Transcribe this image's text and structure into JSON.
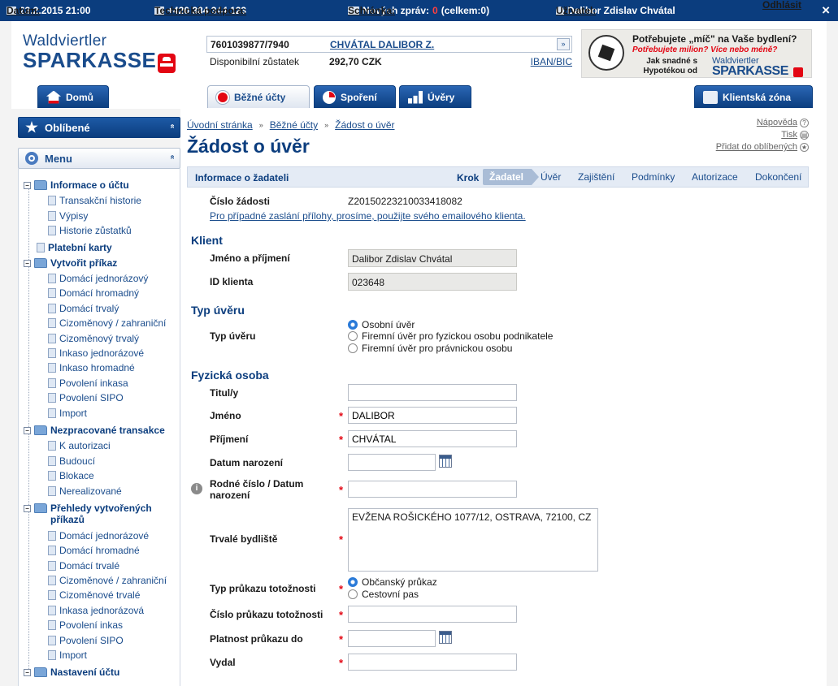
{
  "topbar": {
    "date_label": "Datum:",
    "date_value": "23.2.2015 21:00",
    "support_label": "Technická podpora:",
    "support_value": "+420 384 344 123",
    "inbox_label": "Schránka:",
    "inbox_new": "Nových zpráv:",
    "inbox_zero": "0",
    "inbox_total": "(celkem:0)",
    "user_label": "Uživatel:",
    "user_value": "Dalibor Zdislav Chvátal",
    "logout": "Odhlásit",
    "close": "×"
  },
  "logo": {
    "line1": "Waldviertler",
    "line2": "SPARKASSE"
  },
  "account": {
    "number": "7601039877/7940",
    "owner": "CHVÁTAL DALIBOR Z.",
    "dropdown": "»",
    "balance_label": "Disponibilní zůstatek",
    "balance_value": "292,70 CZK",
    "iban_link": "IBAN/BIC"
  },
  "banner": {
    "t1": "Potřebujete „míč\" na Vaše bydlení?",
    "t2": "Potřebujete milion? Více nebo méně?",
    "t3": "Jak snadné s Hypotékou od",
    "brand1": "Waldviertler",
    "brand2": "SPARKASSE"
  },
  "nav": {
    "home": "Domů",
    "current": "Běžné účty",
    "savings": "Spoření",
    "loans": "Úvěry",
    "client": "Klientská zóna"
  },
  "sidebar": {
    "favorites": "Oblíbené",
    "menu": "Menu",
    "toggle": "»",
    "items": [
      "Informace o účtu",
      "Transakční historie",
      "Výpisy",
      "Historie zůstatků",
      "Platební karty",
      "Vytvořit příkaz",
      "Domácí jednorázový",
      "Domácí hromadný",
      "Domácí trvalý",
      "Cizoměnový / zahraniční",
      "Cizoměnový trvalý",
      "Inkaso jednorázové",
      "Inkaso hromadné",
      "Povolení inkasa",
      "Povolení SIPO",
      "Import",
      "Nezpracované transakce",
      "K autorizaci",
      "Budoucí",
      "Blokace",
      "Nerealizované",
      "Přehledy vytvořených",
      "příkazů",
      "Domácí jednorázové",
      "Domácí hromadné",
      "Domácí trvalé",
      "Cizoměnové / zahraniční",
      "Cizoměnové trvalé",
      "Inkasa jednorázová",
      "Povolení inkas",
      "Povolení SIPO",
      "Import",
      "Nastavení účtu"
    ]
  },
  "breadcrumb": [
    "Úvodní stránka",
    "Běžné účty",
    "Žádost o úvěr"
  ],
  "breadcrumb_sep": "»",
  "page_title": "Žádost o úvěr",
  "utilities": {
    "help": "Nápověda",
    "print": "Tisk",
    "add_fav": "Přidat do oblíbených"
  },
  "steps": {
    "header": "Informace o žadateli",
    "krok": "Krok",
    "items": [
      "Žadatel",
      "Úvěr",
      "Zajištění",
      "Podmínky",
      "Autorizace",
      "Dokončení"
    ]
  },
  "form": {
    "request_no_label": "Číslo žádosti",
    "request_no_value": "Z20150223210033418082",
    "email_note": "Pro případné zaslání přílohy, prosíme, použijte svého emailového klienta.",
    "client_section": "Klient",
    "name_label": "Jméno a příjmení",
    "name_value": "Dalibor Zdislav Chvátal",
    "client_id_label": "ID klienta",
    "client_id_value": "023648",
    "loan_type_section": "Typ úvěru",
    "loan_type_label": "Typ úvěru",
    "loan_types": [
      "Osobní úvěr",
      "Firemní úvěr pro fyzickou osobu podnikatele",
      "Firemní úvěr pro právnickou osobu"
    ],
    "person_section": "Fyzická osoba",
    "title_label": "Titul/y",
    "title_value": "",
    "first_name_label": "Jméno",
    "first_name_value": "DALIBOR",
    "surname_label": "Příjmení",
    "surname_value": "CHVÁTAL",
    "birthdate_label": "Datum narození",
    "birthdate_value": "",
    "birthno_label1": "Rodné číslo / Datum",
    "birthno_label2": "narození",
    "birthno_value": "",
    "address_label": "Trvalé bydliště",
    "address_value": "EVŽENA ROŠICKÉHO 1077/12, OSTRAVA, 72100, CZ",
    "id_type_label": "Typ průkazu totožnosti",
    "id_types": [
      "Občanský průkaz",
      "Cestovní pas"
    ],
    "id_no_label": "Číslo průkazu totožnosti",
    "id_no_value": "",
    "id_validity_label": "Platnost průkazu do",
    "id_validity_value": "",
    "issued_by_label": "Vydal",
    "issued_by_value": "",
    "required_mark": "*",
    "info_mark": "i"
  },
  "colors": {
    "brand_blue": "#0b3d7e",
    "brand_red": "#e30613",
    "link": "#1a4c8c"
  }
}
